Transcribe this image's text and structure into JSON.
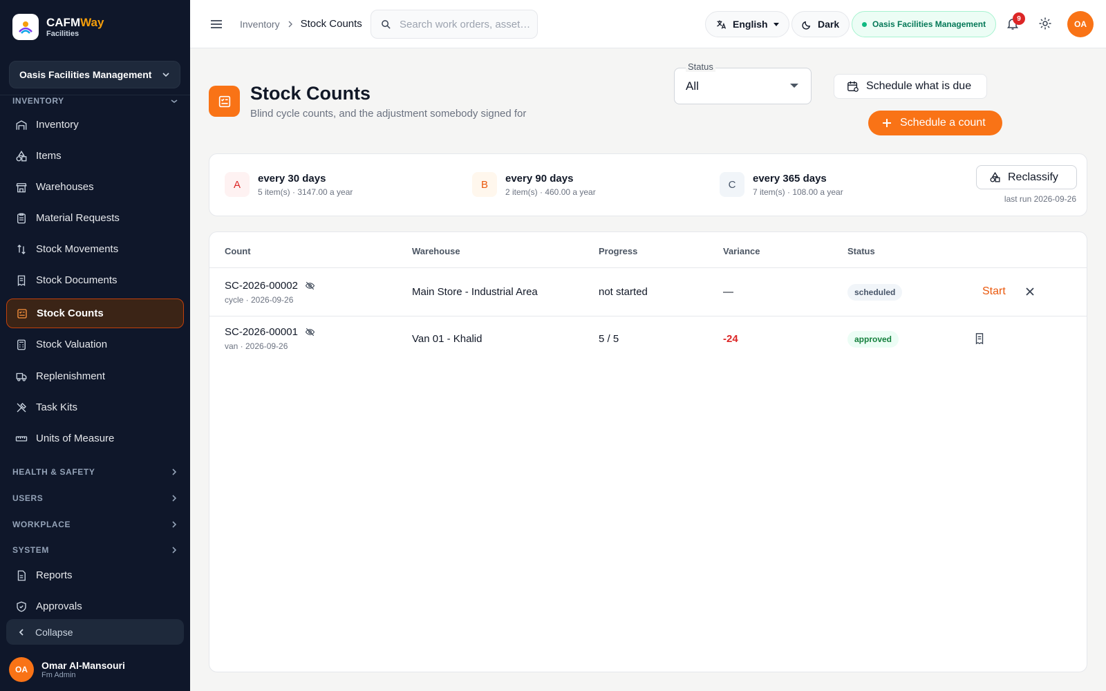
{
  "brand": {
    "name_main": "CAFM",
    "name_accent": "Way",
    "sub": "Facilities"
  },
  "sidebar": {
    "org": "Oasis Facilities Management",
    "section_inventory": "INVENTORY",
    "items": [
      {
        "label": "Inventory",
        "icon": "warehouse-icon"
      },
      {
        "label": "Items",
        "icon": "shapes-icon"
      },
      {
        "label": "Warehouses",
        "icon": "store-icon"
      },
      {
        "label": "Material Requests",
        "icon": "clipboard-icon"
      },
      {
        "label": "Stock Movements",
        "icon": "swap-icon"
      },
      {
        "label": "Stock Documents",
        "icon": "receipt-icon"
      },
      {
        "label": "Stock Counts",
        "icon": "checklist-icon",
        "active": true
      },
      {
        "label": "Stock Valuation",
        "icon": "calculator-icon"
      },
      {
        "label": "Replenishment",
        "icon": "truck-icon"
      },
      {
        "label": "Task Kits",
        "icon": "tools-icon"
      },
      {
        "label": "Units of Measure",
        "icon": "ruler-icon"
      }
    ],
    "sections": [
      "HEALTH & SAFETY",
      "USERS",
      "WORKPLACE",
      "SYSTEM"
    ],
    "bottom_items": [
      {
        "label": "Reports",
        "icon": "report-icon"
      },
      {
        "label": "Approvals",
        "icon": "shield-check-icon"
      }
    ],
    "collapse": "Collapse",
    "user": {
      "initials": "OA",
      "name": "Omar Al-Mansouri",
      "role": "Fm Admin"
    }
  },
  "topbar": {
    "breadcrumb_parent": "Inventory",
    "breadcrumb_current": "Stock Counts",
    "search_placeholder": "Search work orders, asset…",
    "language": "English",
    "theme": "Dark",
    "org_pill": "Oasis Facilities Management",
    "notifications": "9",
    "avatar": "OA"
  },
  "page": {
    "title": "Stock Counts",
    "subtitle": "Blind cycle counts, and the adjustment somebody signed for",
    "status_label": "Status",
    "status_value": "All",
    "schedule_due": "Schedule what is due",
    "schedule_count": "Schedule a count"
  },
  "abc": {
    "classes": [
      {
        "letter": "A",
        "title": "every 30 days",
        "sub": "5 item(s) · 3147.00 a year"
      },
      {
        "letter": "B",
        "title": "every 90 days",
        "sub": "2 item(s) · 460.00 a year"
      },
      {
        "letter": "C",
        "title": "every 365 days",
        "sub": "7 item(s) · 108.00 a year"
      }
    ],
    "reclassify": "Reclassify",
    "last_run": "last run 2026-09-26"
  },
  "table": {
    "columns": [
      "Count",
      "Warehouse",
      "Progress",
      "Variance",
      "Status"
    ],
    "rows": [
      {
        "id": "SC-2026-00002",
        "sub": "cycle · 2026-09-26",
        "warehouse": "Main Store - Industrial Area",
        "progress": "not started",
        "variance": "—",
        "status": "scheduled",
        "action": "Start"
      },
      {
        "id": "SC-2026-00001",
        "sub": "van · 2026-09-26",
        "warehouse": "Van 01 - Khalid",
        "progress": "5 / 5",
        "variance": "-24",
        "status": "approved",
        "action": ""
      }
    ]
  },
  "colors": {
    "accent": "#f97316",
    "sidebar_bg": "#0f172a",
    "variance_negative": "#dc2626"
  }
}
